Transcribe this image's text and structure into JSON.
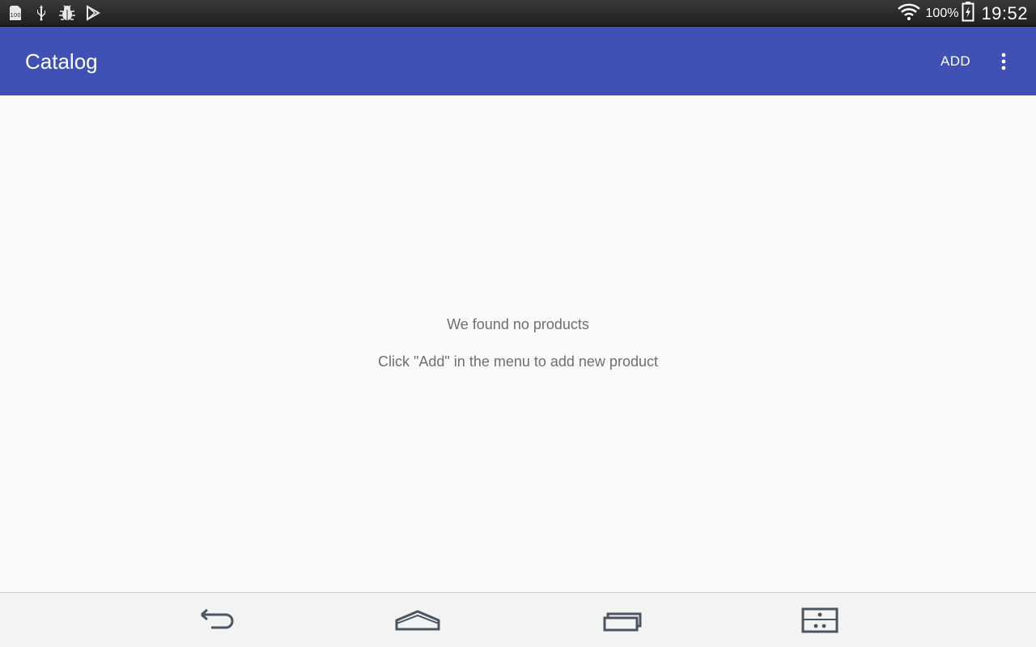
{
  "status_bar": {
    "notification_icons": [
      "storage-icon",
      "usb-icon",
      "debug-bug-icon",
      "play-store-icon"
    ],
    "wifi_icon": "wifi-icon",
    "battery_percent": "100%",
    "battery_icon": "battery-charging-icon",
    "time": "19:52"
  },
  "app_bar": {
    "title": "Catalog",
    "add_label": "ADD",
    "overflow_icon": "more-vert-icon",
    "color": "#3f51b5"
  },
  "empty_state": {
    "title": "We found no products",
    "hint": "Click \"Add\" in the menu to add new product"
  },
  "nav_bar": {
    "buttons": [
      "back-icon",
      "home-icon",
      "recent-apps-icon",
      "split-window-icon"
    ]
  }
}
